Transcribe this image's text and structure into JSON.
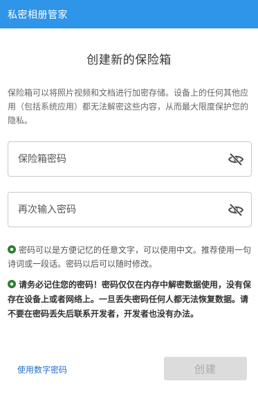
{
  "app": {
    "title": "私密相册管家"
  },
  "page": {
    "title": "创建新的保险箱",
    "description": "保险箱可以将照片视频和文档进行加密存储。设备上的任何其他应用（包括系统应用）都无法解密这些内容，从而最大限度保护您的隐私。"
  },
  "form": {
    "password_placeholder": "保险箱密码",
    "confirm_placeholder": "再次输入密码",
    "visibility_icon": "eye-off-icon"
  },
  "notes": {
    "tip": "密码可以是方便记忆的任意文字，可以使用中文。推荐使用一句诗词或一段话。密码以后可以随时修改。",
    "warning": "请务必记住您的密码！密码仅仅在内存中解密数据使用，没有保存在设备上或者网络上。一旦丢失密码任何人都无法恢复数据。请不要在密码丢失后联系开发者，开发者也没有办法。",
    "bullet_color": "#2e7d32"
  },
  "actions": {
    "numeric_password": "使用数字密码",
    "create": "创建"
  },
  "colors": {
    "primary": "#2f95e9",
    "link": "#1e6fcf",
    "button_disabled": "#dcdcdc"
  }
}
